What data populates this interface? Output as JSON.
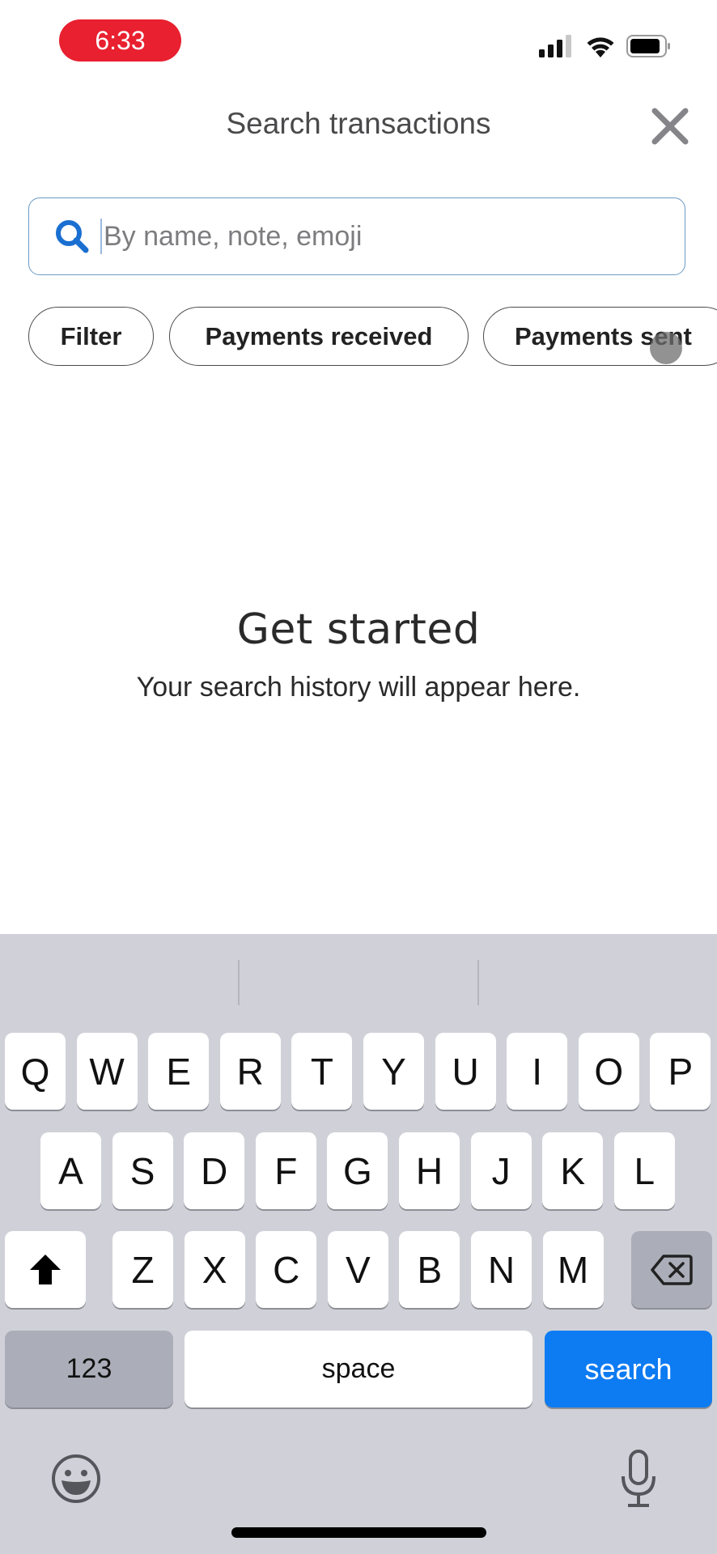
{
  "status_bar": {
    "time": "6:33",
    "icons": [
      "cellular-signal-icon",
      "wifi-icon",
      "battery-icon"
    ],
    "time_pill_color": "#e8202f"
  },
  "header": {
    "title": "Search transactions",
    "close_icon": "close-icon"
  },
  "search": {
    "value": "",
    "placeholder": "By name, note, emoji",
    "icon": "search-icon",
    "accent_color": "#1a6fd1"
  },
  "chips": [
    {
      "label": "Filter"
    },
    {
      "label": "Payments received"
    },
    {
      "label": "Payments sent"
    }
  ],
  "empty_state": {
    "title": "Get started",
    "subtitle": "Your search history will appear here."
  },
  "keyboard": {
    "row1": [
      "Q",
      "W",
      "E",
      "R",
      "T",
      "Y",
      "U",
      "I",
      "O",
      "P"
    ],
    "row2": [
      "A",
      "S",
      "D",
      "F",
      "G",
      "H",
      "J",
      "K",
      "L"
    ],
    "row3": [
      "Z",
      "X",
      "C",
      "V",
      "B",
      "N",
      "M"
    ],
    "shift_icon": "shift-icon",
    "delete_icon": "backspace-icon",
    "numbers_label": "123",
    "space_label": "space",
    "action_label": "search",
    "action_color": "#0d7bf2",
    "emoji_icon": "emoji-icon",
    "mic_icon": "microphone-icon"
  }
}
